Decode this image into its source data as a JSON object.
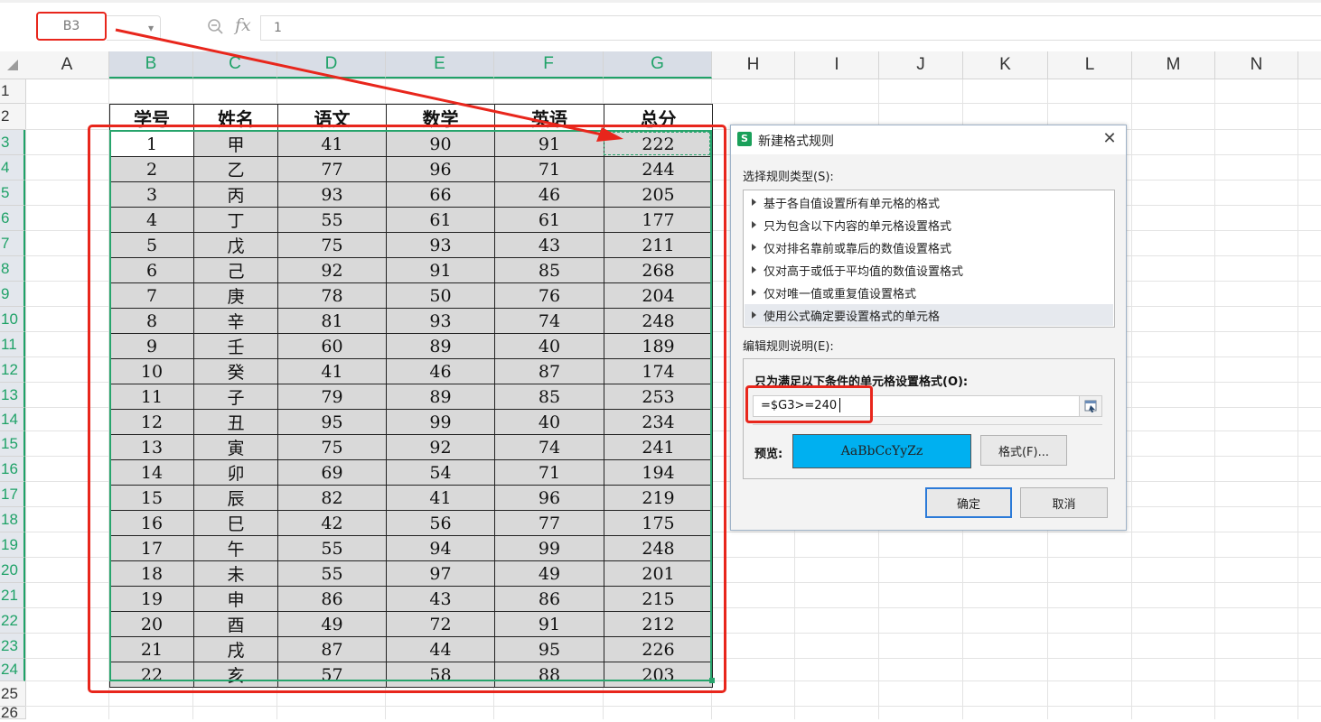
{
  "formula_bar": {
    "name_box": "B3",
    "fx_label": "fx",
    "formula": "1"
  },
  "columns": [
    "A",
    "B",
    "C",
    "D",
    "E",
    "F",
    "G",
    "H",
    "I",
    "J",
    "K",
    "L",
    "M",
    "N"
  ],
  "rows": [
    "1",
    "2",
    "3",
    "4",
    "5",
    "6",
    "7",
    "8",
    "9",
    "10",
    "11",
    "12",
    "13",
    "14",
    "15",
    "16",
    "17",
    "18",
    "19",
    "20",
    "21",
    "22",
    "23",
    "24",
    "25",
    "26"
  ],
  "table": {
    "headers": [
      "学号",
      "姓名",
      "语文",
      "数学",
      "英语",
      "总分"
    ],
    "rows": [
      [
        "1",
        "甲",
        "41",
        "90",
        "91",
        "222"
      ],
      [
        "2",
        "乙",
        "77",
        "96",
        "71",
        "244"
      ],
      [
        "3",
        "丙",
        "93",
        "66",
        "46",
        "205"
      ],
      [
        "4",
        "丁",
        "55",
        "61",
        "61",
        "177"
      ],
      [
        "5",
        "戊",
        "75",
        "93",
        "43",
        "211"
      ],
      [
        "6",
        "己",
        "92",
        "91",
        "85",
        "268"
      ],
      [
        "7",
        "庚",
        "78",
        "50",
        "76",
        "204"
      ],
      [
        "8",
        "辛",
        "81",
        "93",
        "74",
        "248"
      ],
      [
        "9",
        "壬",
        "60",
        "89",
        "40",
        "189"
      ],
      [
        "10",
        "癸",
        "41",
        "46",
        "87",
        "174"
      ],
      [
        "11",
        "子",
        "79",
        "89",
        "85",
        "253"
      ],
      [
        "12",
        "丑",
        "95",
        "99",
        "40",
        "234"
      ],
      [
        "13",
        "寅",
        "75",
        "92",
        "74",
        "241"
      ],
      [
        "14",
        "卯",
        "69",
        "54",
        "71",
        "194"
      ],
      [
        "15",
        "辰",
        "82",
        "41",
        "96",
        "219"
      ],
      [
        "16",
        "巳",
        "42",
        "56",
        "77",
        "175"
      ],
      [
        "17",
        "午",
        "55",
        "94",
        "99",
        "248"
      ],
      [
        "18",
        "未",
        "55",
        "97",
        "49",
        "201"
      ],
      [
        "19",
        "申",
        "86",
        "43",
        "86",
        "215"
      ],
      [
        "20",
        "酉",
        "49",
        "72",
        "91",
        "212"
      ],
      [
        "21",
        "戌",
        "87",
        "44",
        "95",
        "226"
      ],
      [
        "22",
        "亥",
        "57",
        "58",
        "88",
        "203"
      ]
    ]
  },
  "dialog": {
    "logo": "S",
    "title": "新建格式规则",
    "select_type_label": "选择规则类型(S):",
    "rule_types": [
      "基于各自值设置所有单元格的格式",
      "只为包含以下内容的单元格设置格式",
      "仅对排名靠前或靠后的数值设置格式",
      "仅对高于或低于平均值的数值设置格式",
      "仅对唯一值或重复值设置格式",
      "使用公式确定要设置格式的单元格"
    ],
    "edit_label": "编辑规则说明(E):",
    "condition_label": "只为满足以下条件的单元格设置格式(O):",
    "formula": "=$G3>=240",
    "preview_label": "预览:",
    "preview_text": "AaBbCcYyZz",
    "format_button": "格式(F)...",
    "ok_button": "确定",
    "cancel_button": "取消"
  },
  "colors": {
    "accent_green": "#27a46c",
    "annotation_red": "#e8261c",
    "preview_fill": "#00b0f0",
    "data_fill": "#d9d9d9"
  }
}
